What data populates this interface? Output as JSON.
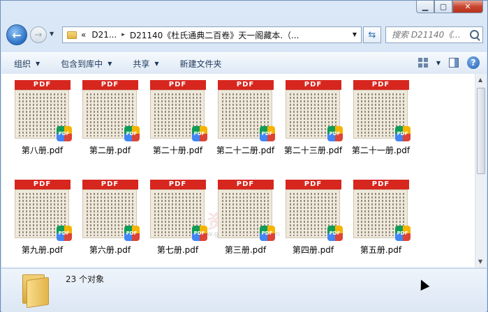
{
  "window": {
    "buttons": {
      "minimize": "▁",
      "maximize": "▢",
      "close": "✕"
    }
  },
  "navbar": {
    "back_icon": "back-arrow-icon",
    "forward_icon": "forward-arrow-icon",
    "address_segments": [
      "«",
      "D21...",
      "▸",
      "D21140《杜氏通典二百卷》天一阁藏本.（..."
    ],
    "search_placeholder": "搜索 D21140《..."
  },
  "toolbar": {
    "organize": "组织",
    "include_in_library": "包含到库中",
    "share": "共享",
    "new_folder": "新建文件夹"
  },
  "files": [
    {
      "name": "第八册.pdf"
    },
    {
      "name": "第二册.pdf"
    },
    {
      "name": "第二十册.pdf"
    },
    {
      "name": "第二十二册.pdf"
    },
    {
      "name": "第二十三册.pdf"
    },
    {
      "name": "第二十一册.pdf"
    },
    {
      "name": "第九册.pdf"
    },
    {
      "name": "第六册.pdf"
    },
    {
      "name": "第七册.pdf"
    },
    {
      "name": "第三册.pdf"
    },
    {
      "name": "第四册.pdf"
    },
    {
      "name": "第五册.pdf"
    }
  ],
  "thumbnail_band": "PDF",
  "thumbnail_badge": "PDF",
  "watermark": {
    "title": "国学资源网",
    "url": "www.guoxueziyuan.com"
  },
  "status": {
    "count": "23 个对象"
  },
  "colors": {
    "pdf_red": "#d7261e",
    "accent": "#2a6fc4"
  }
}
